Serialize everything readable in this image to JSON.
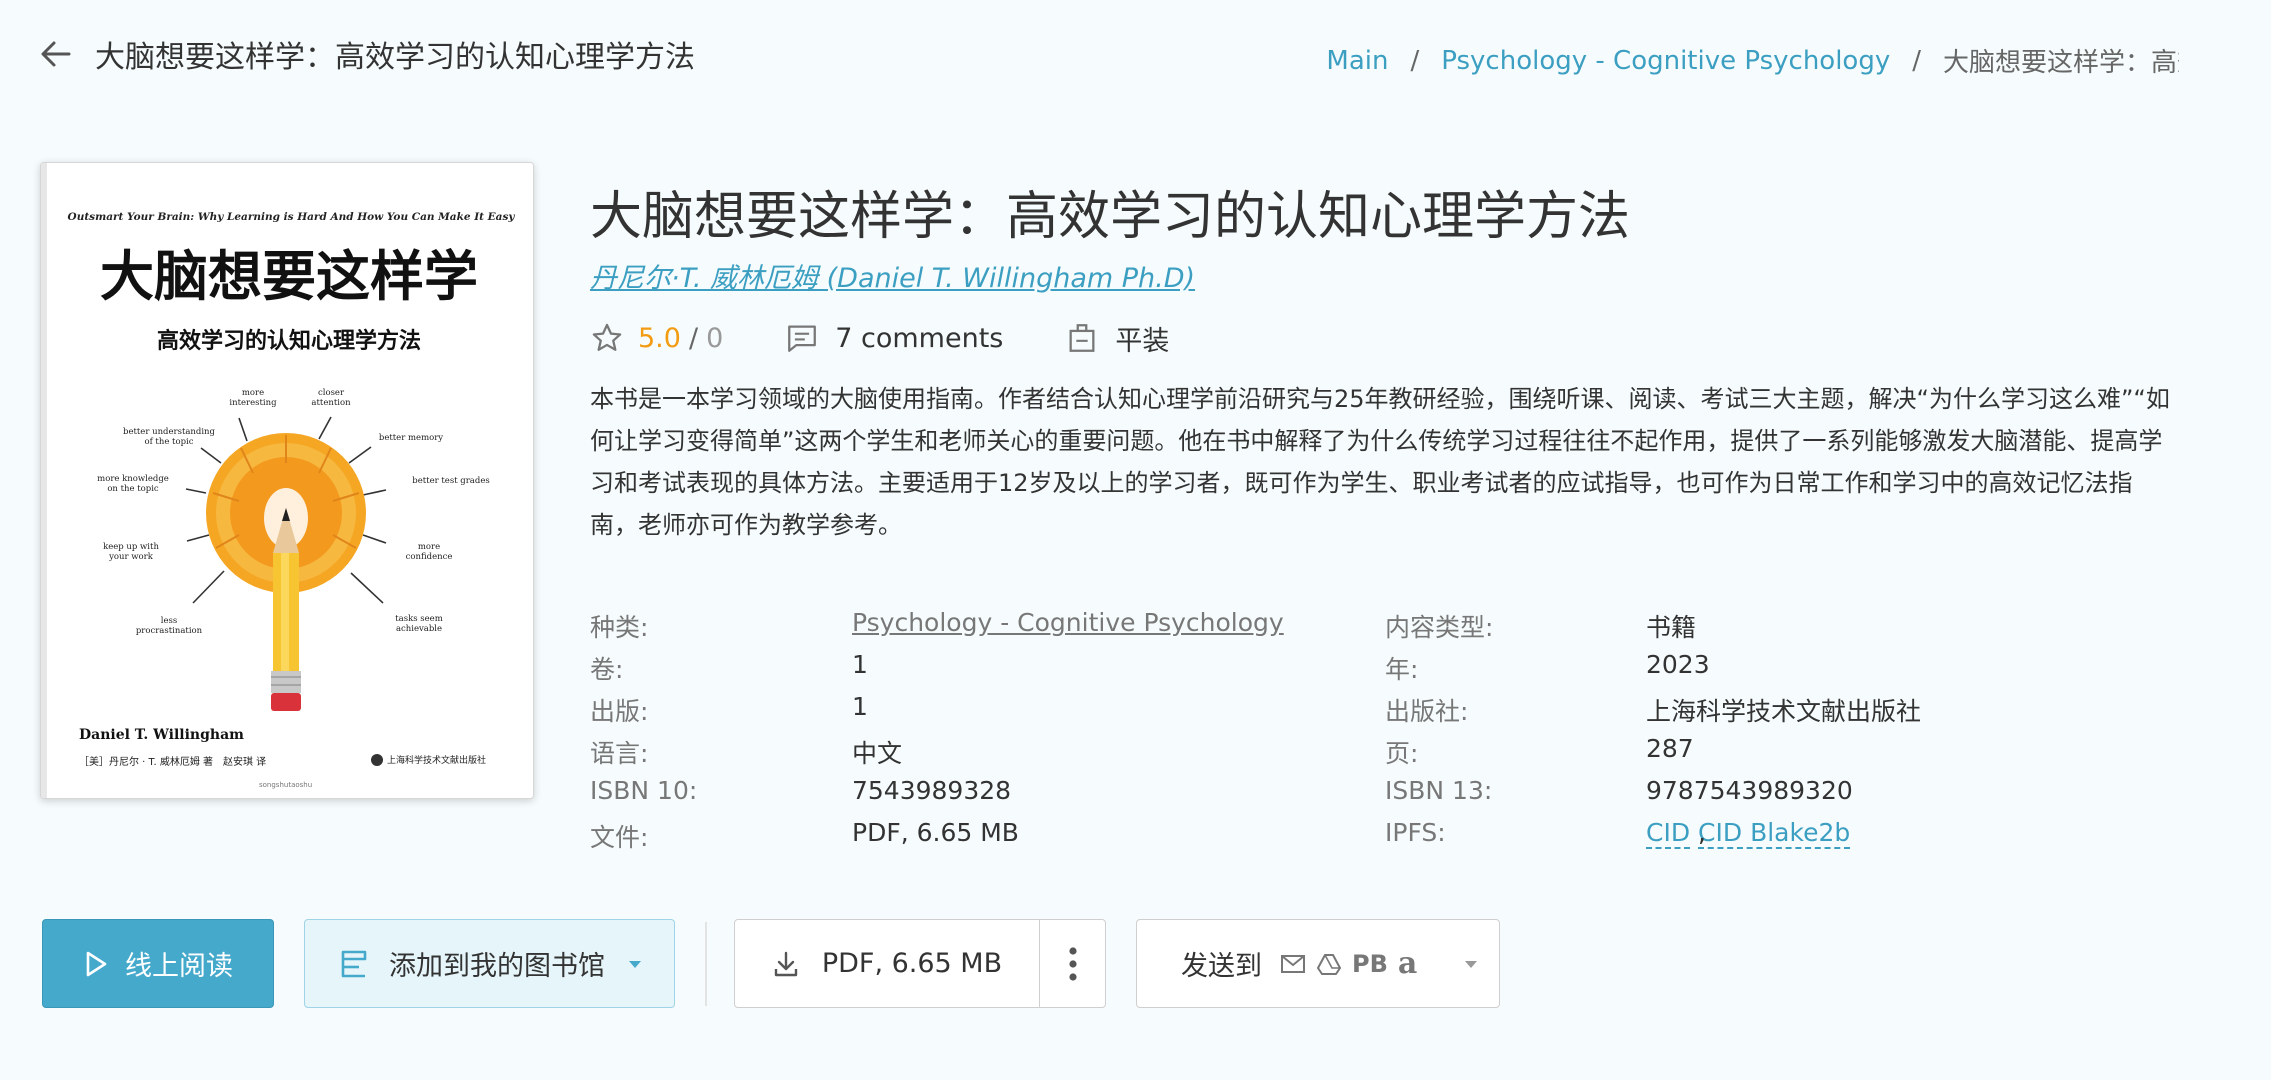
{
  "header": {
    "title": "大脑想要这样学：高效学习的认知心理学方法",
    "breadcrumb": {
      "main": "Main",
      "separator": "/",
      "category": "Psychology - Cognitive Psychology",
      "current": "大脑想要这样学：高效学习的认知心理学方法"
    }
  },
  "cover": {
    "tagline": "Outsmart Your Brain: Why Learning is Hard And How You Can Make It Easy",
    "title": "大脑想要这样学",
    "subtitle": "高效学习的认知心理学方法",
    "labels": {
      "more_interesting": [
        "more",
        "interesting"
      ],
      "closer_attention": [
        "closer",
        "attention"
      ],
      "better_understanding": [
        "better understanding",
        "of the topic"
      ],
      "better_memory": [
        "better memory"
      ],
      "more_knowledge": [
        "more knowledge",
        "on the topic"
      ],
      "better_test_grades": [
        "better test grades"
      ],
      "keep_up": [
        "keep up with",
        "your work"
      ],
      "more_confidence": [
        "more",
        "confidence"
      ],
      "less_procrastination": [
        "less",
        "procrastination"
      ],
      "tasks_achievable": [
        "tasks seem",
        "achievable"
      ]
    },
    "author_en": "Daniel T. Willingham",
    "author_cn": "［美］丹尼尔 · T. 威林厄姆 著　赵安琪 译",
    "publisher": "上海科学技术文献出版社",
    "footer": "songshutaoshu",
    "colors": {
      "shavings": "#f5a623",
      "pencil": "#f7c531",
      "eraser": "#d9323a"
    }
  },
  "book": {
    "title": "大脑想要这样学：高效学习的认知心理学方法",
    "author": "丹尼尔·T. 威林厄姆 (Daniel T. Willingham Ph.D)",
    "rating": "5.0",
    "rating_sep": "/",
    "rating_count": "0",
    "comments": "7 comments",
    "binding": "平装",
    "description": "本书是一本学习领域的大脑使用指南。作者结合认知心理学前沿研究与25年教研经验，围绕听课、阅读、考试三大主题，解决“为什么学习这么难”“如何让学习变得简单”这两个学生和老师关心的重要问题。他在书中解释了为什么传统学习过程往往不起作用，提供了一系列能够激发大脑潜能、提高学习和考试表现的具体方法。主要适用于12岁及以上的学习者，既可作为学生、职业考试者的应试指导，也可作为日常工作和学习中的高效记忆法指南，老师亦可作为教学参考。"
  },
  "metadata": {
    "category_label": "种类:",
    "category_value": "Psychology - Cognitive Psychology",
    "content_type_label": "内容类型:",
    "content_type_value": "书籍",
    "volume_label": "卷:",
    "volume_value": "1",
    "year_label": "年:",
    "year_value": "2023",
    "edition_label": "出版:",
    "edition_value": "1",
    "publisher_label": "出版社:",
    "publisher_value": "上海科学技术文献出版社",
    "language_label": "语言:",
    "language_value": "中文",
    "pages_label": "页:",
    "pages_value": "287",
    "isbn10_label": "ISBN 10:",
    "isbn10_value": "7543989328",
    "isbn13_label": "ISBN 13:",
    "isbn13_value": "9787543989320",
    "file_label": "文件:",
    "file_value": "PDF, 6.65 MB",
    "ipfs_label": "IPFS:",
    "ipfs_cid": "CID",
    "ipfs_sep": ",",
    "ipfs_blake": "CID Blake2b"
  },
  "actions": {
    "read_online": "线上阅读",
    "add_to_library": "添加到我的图书馆",
    "download": "PDF, 6.65 MB",
    "send_to": "发送到",
    "pb": "PB",
    "amazon": "a"
  },
  "icons": {
    "back": "arrow-left-icon",
    "star": "star-icon",
    "comment": "comment-icon",
    "binding": "book-binding-icon",
    "play": "play-icon",
    "library": "library-icon",
    "download": "download-icon",
    "more": "more-vertical-icon",
    "mail": "mail-icon",
    "drive": "drive-icon",
    "amazon": "amazon-icon"
  },
  "colors": {
    "accent": "#45a9cc",
    "link": "#3c9fc2",
    "rating": "#f39c12",
    "background": "#f6fcfd"
  }
}
